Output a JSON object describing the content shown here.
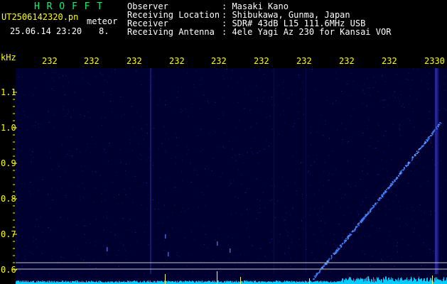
{
  "header": {
    "app_name": "H R O F F T",
    "filename": "UT2506142320.pn",
    "mode": "meteor",
    "datetime": "25.06.14 23:20",
    "count": "8.",
    "info_keys": [
      "Observer",
      "Receiving Location",
      "Receiver",
      "Receiving Antenna"
    ],
    "info_values": [
      ": Masaki Kano",
      ": Shibukawa, Gunma, Japan",
      ": SDR# 43dB L15 111.6MHz USB",
      ": 4ele Yagi Az 230 for Kansai VOR"
    ]
  },
  "axis": {
    "unit": "kHz",
    "time_labels": [
      "232",
      "232",
      "232",
      "232",
      "232",
      "232",
      "232",
      "232",
      "232",
      "2330"
    ],
    "freq_labels": [
      "1.1",
      "1.0",
      "0.9",
      "0.8",
      "0.7",
      "0.6"
    ]
  },
  "colors": {
    "title": "#00ff66",
    "text": "#ffffff",
    "label": "#ffff00",
    "background": "#000030",
    "signal": "#3377ff",
    "spectrum": "#00ccff"
  }
}
